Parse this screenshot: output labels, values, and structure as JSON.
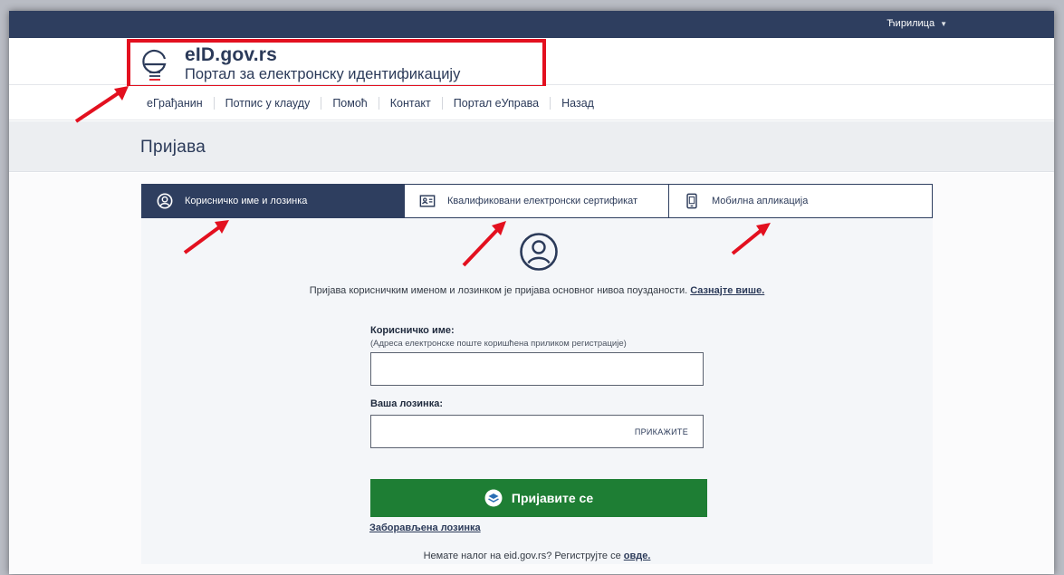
{
  "topbar": {
    "language": "Ћирилица"
  },
  "logo": {
    "title": "eID.gov.rs",
    "subtitle": "Портал за електронску идентификацију"
  },
  "nav": {
    "items": [
      "еГрађанин",
      "Потпис у клауду",
      "Помоћ",
      "Контакт",
      "Портал еУправа",
      "Назад"
    ]
  },
  "page": {
    "title": "Пријава"
  },
  "tabs": [
    {
      "label": "Корисничко име и лозинка",
      "icon": "user-circle-icon"
    },
    {
      "label": "Квалификовани електронски сертификат",
      "icon": "id-card-icon"
    },
    {
      "label": "Мобилна апликација",
      "icon": "mobile-phone-icon"
    }
  ],
  "intro": {
    "text": "Пријава корисничким именом и лозинком је пријава основног нивоа поузданости. ",
    "link": "Сазнајте више."
  },
  "form": {
    "username_label": "Корисничко име:",
    "username_hint": "(Адреса електронске поште коришћена приликом регистрације)",
    "username_value": "",
    "password_label": "Ваша лозинка:",
    "password_value": "",
    "show_password": "ПРИКАЖИТЕ",
    "submit": "Пријавите се",
    "forgot": "Заборављена лозинка"
  },
  "register": {
    "text": "Немате налог на eid.gov.rs? Региструјте се ",
    "link": "овде."
  },
  "colors": {
    "navy": "#2e3e5f",
    "highlight_red": "#e3101f",
    "submit_green": "#1e7e34"
  }
}
